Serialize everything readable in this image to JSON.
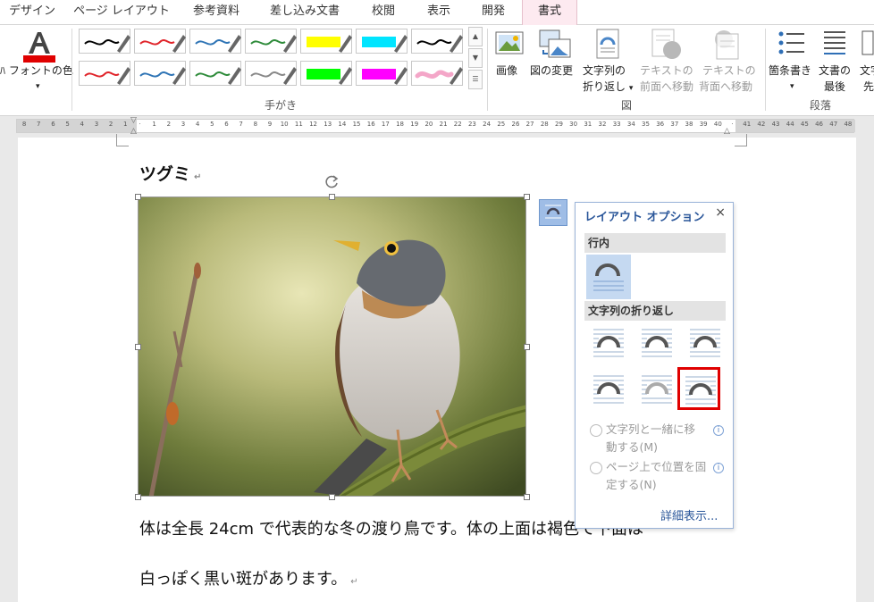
{
  "tabs": [
    "デザイン",
    "ページ レイアウト",
    "参考資料",
    "差し込み文書",
    "校閲",
    "表示",
    "開発",
    "書式"
  ],
  "ribbon": {
    "font_color_label": "フォントの色",
    "pens_group_label": "手がき",
    "insert_picture_label": "画像",
    "change_picture_label": "図の変更",
    "wrap_text_label_1": "文字列の",
    "wrap_text_label_2": "折り返し",
    "bring_forward_label_1": "テキストの",
    "bring_forward_label_2": "前面へ移動",
    "send_backward_label_1": "テキストの",
    "send_backward_label_2": "背面へ移動",
    "picture_group_label": "図",
    "bullets_label": "箇条書き",
    "doc_end_label_1": "文書の",
    "doc_end_label_2": "最後",
    "next_label_1": "文字",
    "next_label_2": "先",
    "paragraph_group_label": "段落",
    "pen_colors": [
      "#000000",
      "#e0242a",
      "#2e74b5",
      "#2e8b3a",
      "#ffff00",
      "#00e5ff",
      "#000000",
      "#e0242a",
      "#2e74b5",
      "#2e8b3a",
      "#888888",
      "#00ff00",
      "#ff00ff",
      "#f4a6c8"
    ]
  },
  "ruler": {
    "ticks": [
      "8",
      "7",
      "6",
      "5",
      "4",
      "3",
      "2",
      "1",
      "",
      "1",
      "2",
      "3",
      "4",
      "5",
      "6",
      "7",
      "8",
      "9",
      "10",
      "11",
      "12",
      "13",
      "14",
      "15",
      "16",
      "17",
      "18",
      "19",
      "20",
      "21",
      "22",
      "23",
      "24",
      "25",
      "26",
      "27",
      "28",
      "29",
      "30",
      "31",
      "32",
      "33",
      "34",
      "35",
      "36",
      "37",
      "38",
      "39",
      "40",
      "",
      "41",
      "42",
      "43",
      "44",
      "45",
      "46",
      "47",
      "48"
    ]
  },
  "document": {
    "heading": "ツグミ",
    "paragraph_mark": "↵",
    "line1": "体は全長 24cm で代表的な冬の渡り鳥です。体の上面は褐色で下面は",
    "line2": "白っぽく黒い斑があります。"
  },
  "layout_panel": {
    "title": "レイアウト オプション",
    "close": "×",
    "inline_section": "行内",
    "wrap_section": "文字列の折り返し",
    "move_with_text_1": "文字列と一緒に移",
    "move_with_text_2": "動する(M)",
    "fix_position_1": "ページ上で位置を固",
    "fix_position_2": "定する(N)",
    "info": "i",
    "more": "詳細表示..."
  },
  "colors": {
    "accent": "#2b579a",
    "active_tab": "#fdeaf0",
    "highlight": "#c5d9f1",
    "selected_border": "#e00000"
  }
}
